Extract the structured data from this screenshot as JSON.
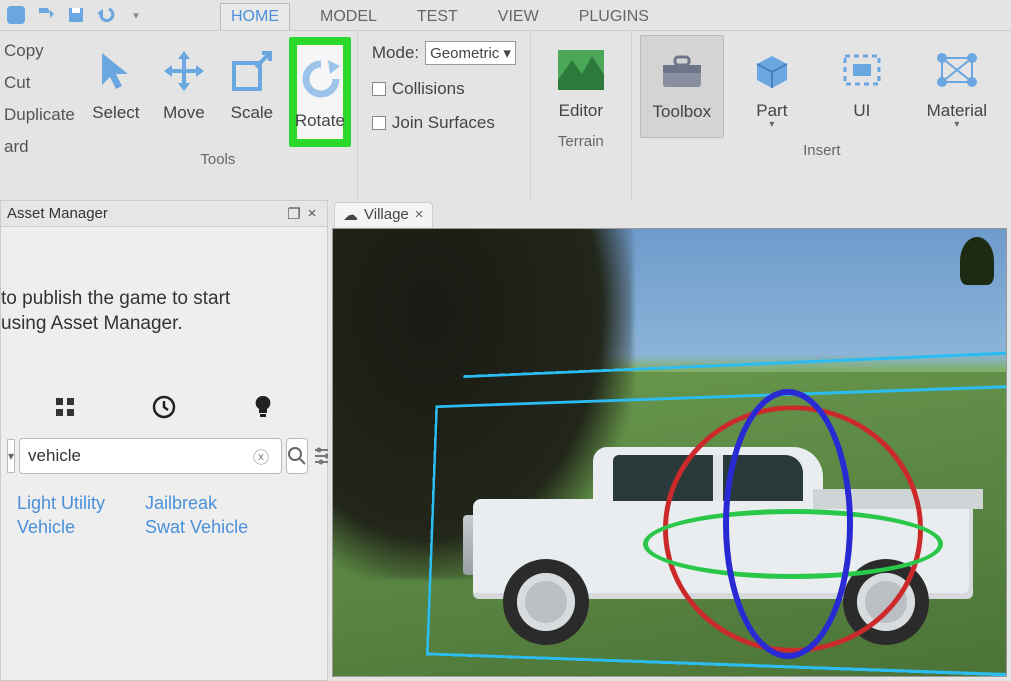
{
  "menu": {
    "tabs": [
      "HOME",
      "MODEL",
      "TEST",
      "VIEW",
      "PLUGINS"
    ],
    "active": "HOME"
  },
  "clipboard": {
    "copy": "Copy",
    "cut": "Cut",
    "duplicate": "Duplicate",
    "extra": "ard"
  },
  "tools": {
    "select": "Select",
    "move": "Move",
    "scale": "Scale",
    "rotate": "Rotate",
    "group_label": "Tools"
  },
  "mode": {
    "label": "Mode:",
    "value": "Geometric",
    "collisions": "Collisions",
    "join": "Join Surfaces"
  },
  "terrain": {
    "editor": "Editor",
    "group_label": "Terrain"
  },
  "insert": {
    "toolbox": "Toolbox",
    "part": "Part",
    "ui": "UI",
    "material": "Material",
    "group_label": "Insert"
  },
  "asset_panel": {
    "title": "Asset Manager",
    "message": "to publish the game to start using Asset Manager.",
    "message_line1": "to publish the game to start",
    "message_line2": "using Asset Manager.",
    "search_value": "vehicle",
    "results": {
      "col1a": "Light Utility",
      "col1b": "Vehicle",
      "col2a": "Jailbreak",
      "col2b": "Swat Vehicle"
    }
  },
  "viewport": {
    "tab_name": "Village"
  },
  "icons": {
    "cloud": "☁",
    "close": "×",
    "dropdown": "▾",
    "popout": "❐",
    "grid": "▦",
    "clock": "◔",
    "bulb": "●",
    "search": "⌕",
    "filter": "≡"
  }
}
